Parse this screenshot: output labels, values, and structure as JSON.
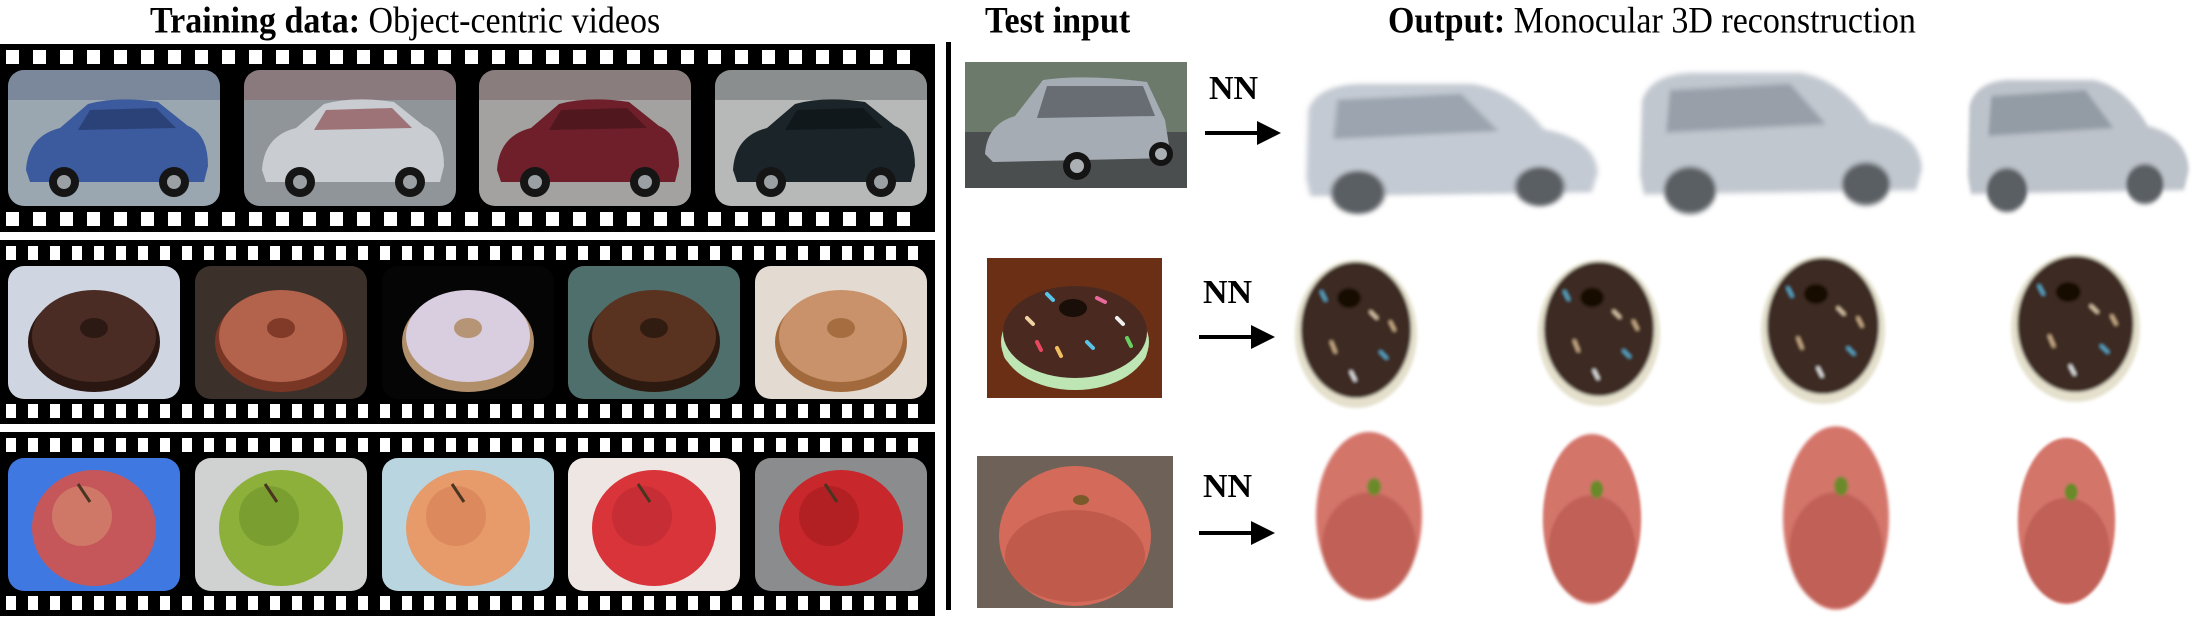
{
  "titles": {
    "training_bold": "Training data:",
    "training_rest": " Object-centric videos",
    "test": "Test input",
    "output_bold": "Output:",
    "output_rest": " Monocular 3D reconstruction"
  },
  "training_strips": [
    {
      "category": "car",
      "frames": [
        {
          "label": "blue hatchback car",
          "colors": [
            "#9aa6b0",
            "#3c5a9e",
            "#1e2f5a"
          ]
        },
        {
          "label": "silver hatchback rear view",
          "colors": [
            "#8f9599",
            "#c9ccd0",
            "#7a2a2e"
          ]
        },
        {
          "label": "dark red hatchback car",
          "colors": [
            "#a3a2a0",
            "#6e1f2a",
            "#3a1015"
          ]
        },
        {
          "label": "black hatchback car",
          "colors": [
            "#b6b9b8",
            "#1b2529",
            "#0a0f12"
          ]
        }
      ]
    },
    {
      "category": "donut",
      "frames": [
        {
          "label": "chocolate frosted donut",
          "colors": [
            "#cfd6e2",
            "#4a2c24",
            "#2a1712"
          ]
        },
        {
          "label": "pink glazed donut",
          "colors": [
            "#3c302a",
            "#b3624c",
            "#7a3624"
          ]
        },
        {
          "label": "sprinkled white donut",
          "colors": [
            "#050505",
            "#d9cde0",
            "#b08f6a"
          ]
        },
        {
          "label": "chocolate donut on plate",
          "colors": [
            "#4e6f6c",
            "#5a3220",
            "#2c1a10"
          ]
        },
        {
          "label": "pink sprinkled donut",
          "colors": [
            "#e3dad2",
            "#c9926a",
            "#a26a3c"
          ]
        }
      ]
    },
    {
      "category": "apple",
      "frames": [
        {
          "label": "red-yellow apple",
          "colors": [
            "#3f78e0",
            "#c5575a",
            "#e6b880"
          ]
        },
        {
          "label": "green apple",
          "colors": [
            "#d0d2d2",
            "#8cb03a",
            "#5a7e1c"
          ]
        },
        {
          "label": "orange apple",
          "colors": [
            "#b9d6e0",
            "#e79a6a",
            "#c96a45"
          ]
        },
        {
          "label": "red apple",
          "colors": [
            "#eee6e2",
            "#d8343a",
            "#a5232a"
          ]
        },
        {
          "label": "deep red apple",
          "colors": [
            "#8b8c8e",
            "#c8272c",
            "#8a1418"
          ]
        }
      ]
    }
  ],
  "test_rows": [
    {
      "category": "car",
      "nn_label": "NN",
      "input": {
        "label": "silver minivan input",
        "colors": [
          "#6c7a6c",
          "#a6acb4",
          "#3e4246"
        ]
      },
      "outputs": [
        {
          "label": "car reconstruction view 1",
          "colors": [
            "#c4cad3",
            "#8d97a3"
          ]
        },
        {
          "label": "car reconstruction view 2",
          "colors": [
            "#c1c7cf",
            "#8a929c"
          ]
        },
        {
          "label": "car reconstruction view 3",
          "colors": [
            "#bdc3cb",
            "#858d97"
          ]
        }
      ]
    },
    {
      "category": "donut",
      "nn_label": "NN",
      "input": {
        "label": "sprinkled chocolate donut input",
        "colors": [
          "#6b2f16",
          "#3a2218",
          "#bde6b4"
        ]
      },
      "outputs": [
        {
          "label": "donut reconstruction view 1",
          "colors": [
            "#3e2a22",
            "#e4e0cc"
          ]
        },
        {
          "label": "donut reconstruction view 2",
          "colors": [
            "#3e2a22",
            "#e4e0cc"
          ]
        },
        {
          "label": "donut reconstruction view 3",
          "colors": [
            "#3e2a22",
            "#e4e0cc"
          ]
        },
        {
          "label": "donut reconstruction view 4",
          "colors": [
            "#3e2a22",
            "#e4e0cc"
          ]
        }
      ]
    },
    {
      "category": "apple",
      "nn_label": "NN",
      "input": {
        "label": "red apple input",
        "colors": [
          "#6e6258",
          "#d46b5a",
          "#a8473a"
        ]
      },
      "outputs": [
        {
          "label": "apple reconstruction view 1",
          "colors": [
            "#d4756a",
            "#a94a40"
          ]
        },
        {
          "label": "apple reconstruction view 2",
          "colors": [
            "#d4756a",
            "#a94a40"
          ]
        },
        {
          "label": "apple reconstruction view 3",
          "colors": [
            "#d4756a",
            "#a94a40"
          ]
        },
        {
          "label": "apple reconstruction view 4",
          "colors": [
            "#d4756a",
            "#a94a40"
          ]
        }
      ]
    }
  ]
}
